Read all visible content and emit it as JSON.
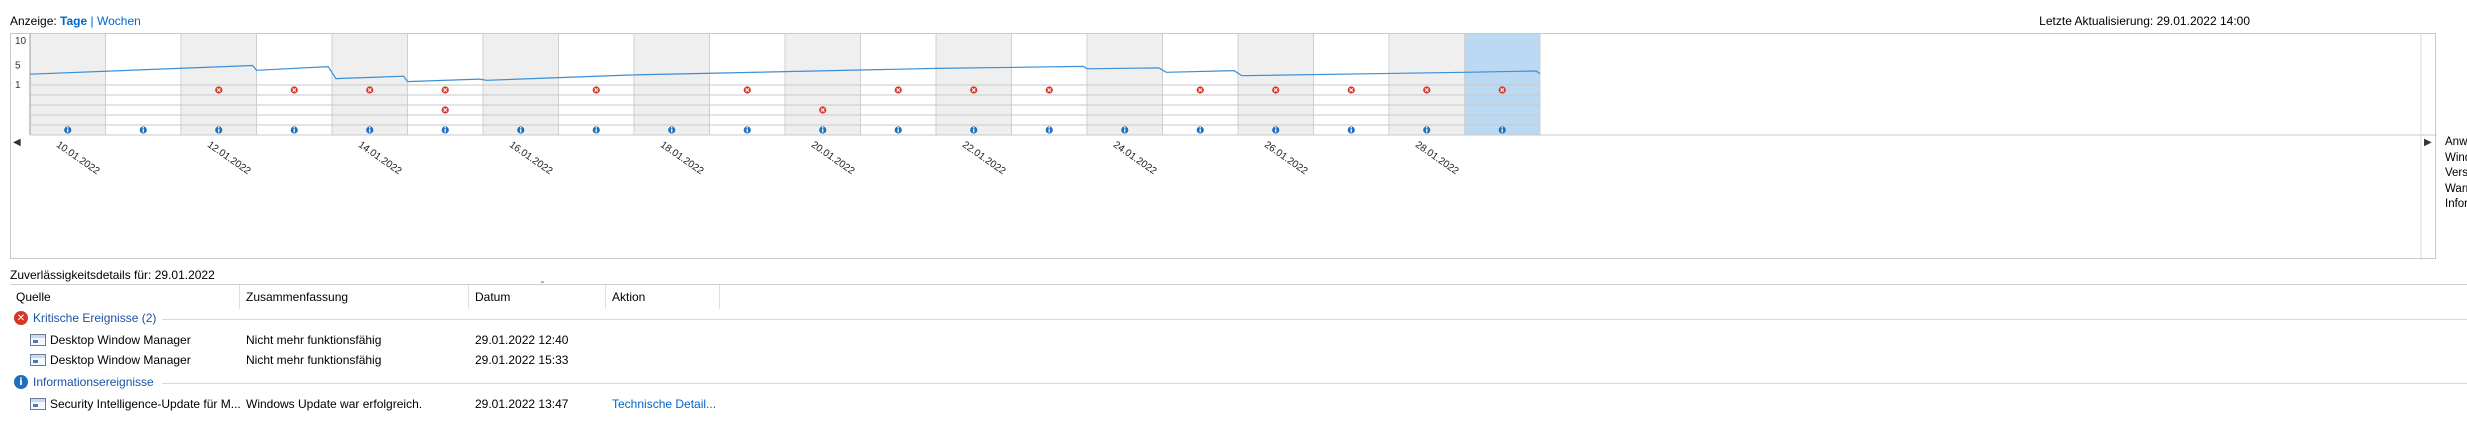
{
  "view": {
    "label": "Anzeige:",
    "days": "Tage",
    "separator": "|",
    "weeks": "Wochen"
  },
  "last_update": "Letzte Aktualisierung: 29.01.2022 14:00",
  "chart_data": {
    "type": "line",
    "title": "",
    "ylabel": "",
    "xlabel": "",
    "y_ticks": [
      "10",
      "5",
      "1"
    ],
    "ylim": [
      1,
      10
    ],
    "days": 20,
    "date_labels": [
      "10.01.2022",
      "12.01.2022",
      "14.01.2022",
      "16.01.2022",
      "18.01.2022",
      "20.01.2022",
      "22.01.2022",
      "24.01.2022",
      "26.01.2022",
      "28.01.2022"
    ],
    "stability_index": [
      [
        0.0,
        3.0
      ],
      [
        2.95,
        4.78
      ],
      [
        3.0,
        3.8
      ],
      [
        3.95,
        4.55
      ],
      [
        4.05,
        2.1
      ],
      [
        4.95,
        2.6
      ],
      [
        5.0,
        1.5
      ],
      [
        5.95,
        2.0
      ],
      [
        6.05,
        1.75
      ],
      [
        7.95,
        2.85
      ],
      [
        12.0,
        4.2
      ],
      [
        13.95,
        4.6
      ],
      [
        14.0,
        4.1
      ],
      [
        14.95,
        4.3
      ],
      [
        15.05,
        3.4
      ],
      [
        15.95,
        3.75
      ],
      [
        16.05,
        2.7
      ],
      [
        19.0,
        3.4
      ],
      [
        19.95,
        3.65
      ],
      [
        20.0,
        3.1
      ]
    ],
    "rows": [
      {
        "name": "Anwendungsfehler",
        "events": [
          2,
          3,
          4,
          5,
          7,
          9,
          11,
          12,
          13,
          15,
          16,
          17,
          18,
          19
        ]
      },
      {
        "name": "Windows-Fehler",
        "events": []
      },
      {
        "name": "Verschiedene Fehler",
        "events": [
          5,
          10
        ]
      },
      {
        "name": "Warnungen",
        "events": []
      },
      {
        "name": "Informationsereignisse",
        "events": [
          0,
          1,
          2,
          3,
          4,
          5,
          6,
          7,
          8,
          9,
          10,
          11,
          12,
          13,
          14,
          15,
          16,
          17,
          18,
          19
        ]
      }
    ],
    "selected_day": 19,
    "grid": true
  },
  "legend": [
    "Anwendungsfehler",
    "Windows-Fehler",
    "Verschiedene Fehler",
    "Warnungen",
    "Informationsereignisse"
  ],
  "details": {
    "title": "Zuverlässigkeitsdetails für: 29.01.2022",
    "columns": [
      "Quelle",
      "Zusammenfassung",
      "Datum",
      "Aktion"
    ],
    "groups": [
      {
        "label": "Kritische Ereignisse (2)",
        "icon": "critical-icon",
        "rows": [
          {
            "source": "Desktop Window Manager",
            "summary": "Nicht mehr funktionsfähig",
            "date": "29.01.2022 12:40",
            "action": ""
          },
          {
            "source": "Desktop Window Manager",
            "summary": "Nicht mehr funktionsfähig",
            "date": "29.01.2022 15:33",
            "action": ""
          }
        ]
      },
      {
        "label": "Informationsereignisse",
        "icon": "info-icon",
        "rows": [
          {
            "source": "Security Intelligence-Update für M...",
            "summary": "Windows Update war erfolgreich.",
            "date": "29.01.2022 13:47",
            "action": "Technische Detail..."
          }
        ]
      }
    ]
  },
  "colors": {
    "line": "#3a8fd8",
    "critical": "#d9362a",
    "info": "#1f6fc0",
    "shade": "#efefef",
    "selected": "#bcd9f3",
    "link": "#0066cc"
  }
}
